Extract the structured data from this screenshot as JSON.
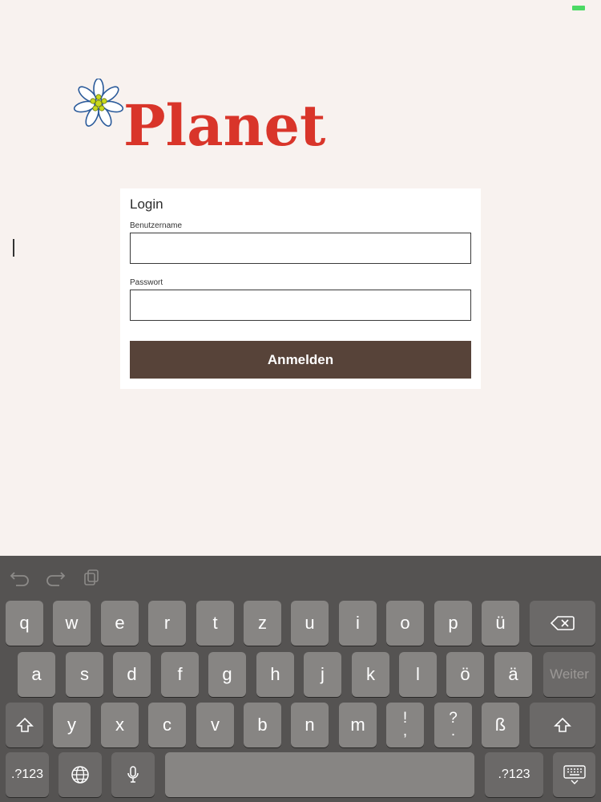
{
  "brand": {
    "name": "Planet",
    "color": "#d9352a"
  },
  "login": {
    "title": "Login",
    "username_label": "Benutzername",
    "username_value": "",
    "password_label": "Passwort",
    "password_value": "",
    "submit_label": "Anmelden",
    "button_color": "#574339"
  },
  "keyboard": {
    "toolbar": [
      "undo-icon",
      "redo-icon",
      "paste-icon"
    ],
    "row1": [
      "q",
      "w",
      "e",
      "r",
      "t",
      "z",
      "u",
      "i",
      "o",
      "p",
      "ü"
    ],
    "row2": [
      "a",
      "s",
      "d",
      "f",
      "g",
      "h",
      "j",
      "k",
      "l",
      "ö",
      "ä"
    ],
    "row3": [
      "y",
      "x",
      "c",
      "v",
      "b",
      "n",
      "m"
    ],
    "row3_punct": [
      {
        "top": "!",
        "bottom": ","
      },
      {
        "top": "?",
        "bottom": "."
      }
    ],
    "row3_extra": "ß",
    "return_label": "Weiter",
    "numbers_label": ".?123",
    "space_label": ""
  }
}
